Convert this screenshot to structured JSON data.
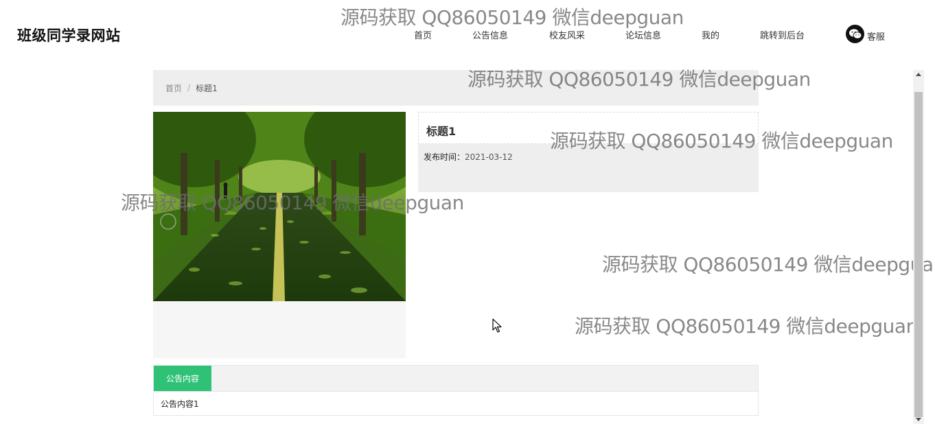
{
  "header": {
    "site_title": "班级同学录网站",
    "nav": [
      {
        "label": "首页"
      },
      {
        "label": "公告信息"
      },
      {
        "label": "校友风采"
      },
      {
        "label": "论坛信息"
      },
      {
        "label": "我的"
      },
      {
        "label": "跳转到后台"
      }
    ],
    "service_label": "客服",
    "service_icon": "wechat-icon"
  },
  "breadcrumb": {
    "home": "首页",
    "separator": "/",
    "current": "标题1"
  },
  "detail": {
    "title": "标题1",
    "date_label": "发布时间：",
    "date_value": "2021-03-12"
  },
  "content": {
    "tab_label": "公告内容",
    "text": "公告内容1"
  },
  "watermark_text": "源码获取 QQ86050149 微信deepguan",
  "colors": {
    "accent_green": "#2fc277",
    "panel_gray": "#eeeeee"
  }
}
